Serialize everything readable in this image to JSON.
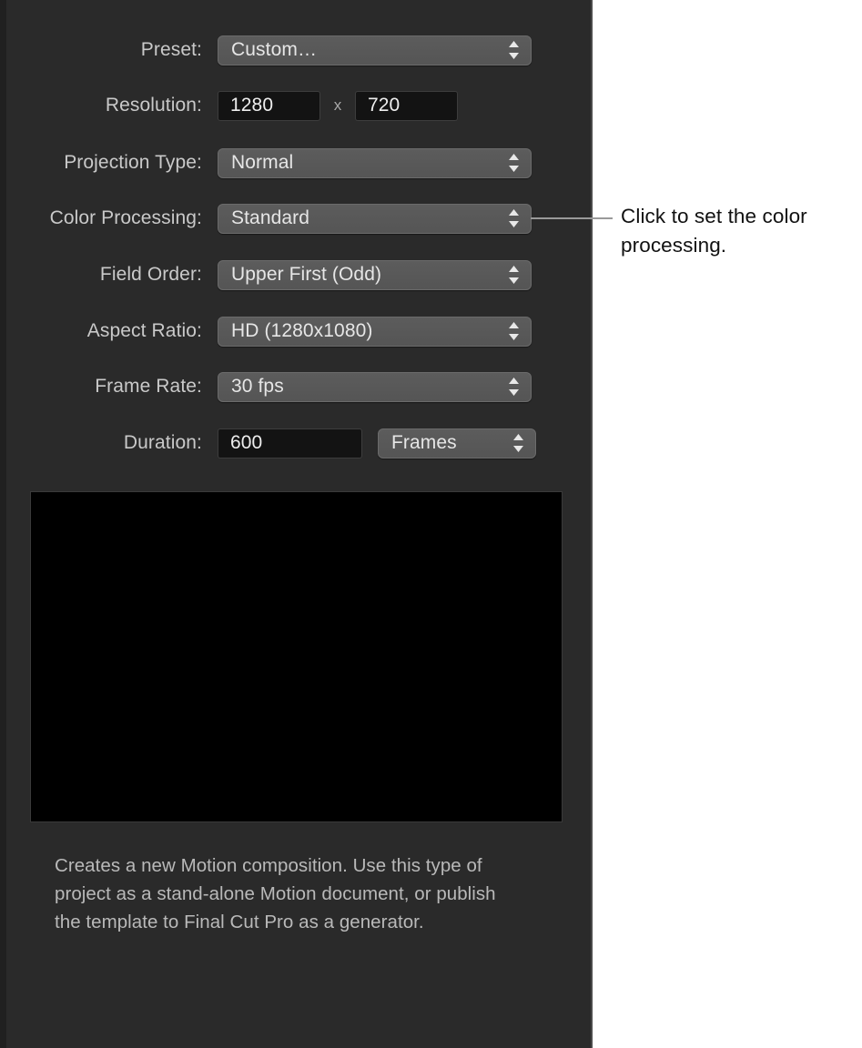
{
  "panel": {
    "rows": [
      {
        "label": "Preset:",
        "control": "popup",
        "value": "Custom…"
      },
      {
        "label": "Resolution:",
        "control": "resolution",
        "value": "1280",
        "separator": "x",
        "value2": "720"
      },
      {
        "label": "Projection Type:",
        "control": "popup",
        "value": "Normal"
      },
      {
        "label": "Color Processing:",
        "control": "popup",
        "value": "Standard"
      },
      {
        "label": "Field Order:",
        "control": "popup",
        "value": "Upper First (Odd)"
      },
      {
        "label": "Aspect Ratio:",
        "control": "popup",
        "value": "HD (1280x1080)"
      },
      {
        "label": "Frame Rate:",
        "control": "popup",
        "value": "30 fps"
      },
      {
        "label": "Duration:",
        "control": "duration",
        "value": "600",
        "units": "Frames"
      }
    ],
    "description": "Creates a new Motion composition. Use this type of project as a stand-alone Motion document, or publish the template to Final Cut Pro as a generator."
  },
  "callout": {
    "text": "Click to set the color processing."
  },
  "colors": {
    "panel_background": "#2a2a2a",
    "popup_fill": "#5a5a5a",
    "field_fill": "#131313",
    "label_text": "#c9c9c9",
    "value_text": "#e6e6e6",
    "description_text": "#b9b9b9",
    "preview_fill": "#000000",
    "callout_line": "#9a9a9a",
    "callout_text": "#111111",
    "page_background": "#ffffff"
  },
  "icons": {
    "stepper": "chevron-up-down-icon"
  }
}
